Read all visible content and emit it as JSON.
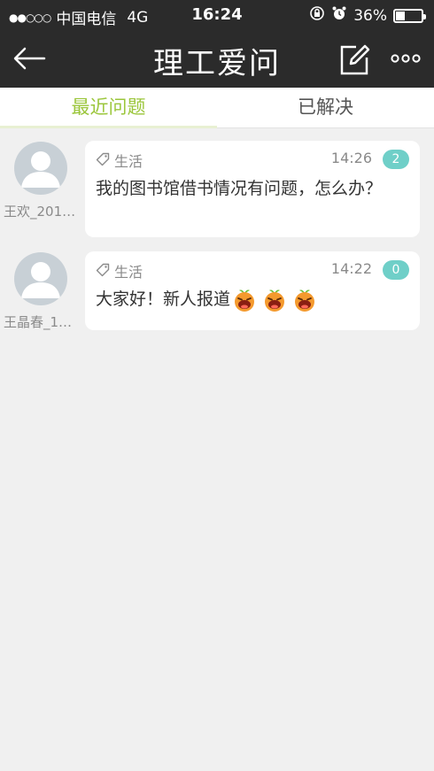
{
  "status_bar": {
    "signal": "●●○○○",
    "carrier": "中国电信",
    "network": "4G",
    "time": "16:24",
    "battery_percent": "36%",
    "battery_level": 0.36
  },
  "nav": {
    "title": "理工爱问",
    "back_icon": "back-arrow-icon",
    "compose_icon": "compose-icon",
    "more_icon": "more-icon"
  },
  "tabs": [
    {
      "label": "最近问题",
      "active": true
    },
    {
      "label": "已解决",
      "active": false
    }
  ],
  "colors": {
    "accent_green": "#9bc63b",
    "badge_teal": "#6fcfc8",
    "header_bg": "#2b2b2b",
    "page_bg": "#f0f0f0"
  },
  "questions": [
    {
      "user": "王欢_201…",
      "category": "生活",
      "time": "14:26",
      "answers": "2",
      "content": "我的图书馆借书情况有问题，怎么办？"
    },
    {
      "user": "王晶春_1…",
      "category": "生活",
      "time": "14:22",
      "answers": "0",
      "content": "大家好！新人报道",
      "emojis": [
        "orange-laugh-emoji",
        "orange-laugh-emoji",
        "orange-laugh-emoji"
      ]
    }
  ]
}
